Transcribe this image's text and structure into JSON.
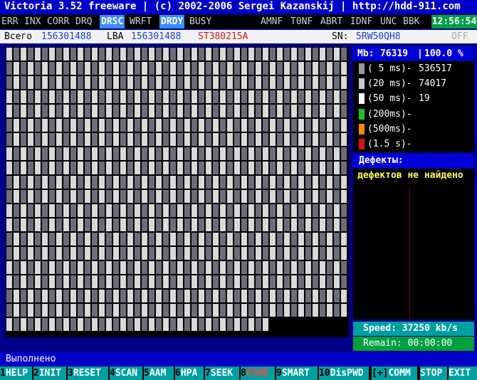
{
  "title_bar": {
    "app": "Victoria 3.52 freeware",
    "copyright": "(c) 2002-2006",
    "author": "Sergei Kazanskij",
    "url": "http://hdd-911.com"
  },
  "status_bar": {
    "flags_left": [
      {
        "label": "ERR",
        "active": false
      },
      {
        "label": "INX",
        "active": false
      },
      {
        "label": "CORR",
        "active": false
      },
      {
        "label": "DRQ",
        "active": false
      },
      {
        "label": "DRSC",
        "active": true
      },
      {
        "label": "WRFT",
        "active": false
      },
      {
        "label": "DRDY",
        "active": true
      },
      {
        "label": "BUSY",
        "active": false
      }
    ],
    "flags_right": [
      {
        "label": "AMNF"
      },
      {
        "label": "T0NF"
      },
      {
        "label": "ABRT"
      },
      {
        "label": "IDNF"
      },
      {
        "label": "UNC"
      },
      {
        "label": "BBK"
      }
    ],
    "clock": "12:56:54"
  },
  "info_bar": {
    "total_label": "Всего",
    "total_value": "156301488",
    "lba_label": "LBA",
    "lba_value": "156301488",
    "model": "ST380215A",
    "sn_label": "SN:",
    "sn_value": "5RW50QH8",
    "off": "OFF"
  },
  "progress": {
    "mb_label": "Mb:",
    "mb_value": "76319",
    "percent": "100.0 %"
  },
  "timing_stats": [
    {
      "label": "( 5 ms)-",
      "value": "536517",
      "color": "#9a9a9a"
    },
    {
      "label": "(20 ms)-",
      "value": "74017",
      "color": "#c8c8c8"
    },
    {
      "label": "(50 ms)-",
      "value": "19",
      "color": "#ffffff"
    },
    {
      "label": "(200ms)-",
      "value": "",
      "color": "#20c020"
    },
    {
      "label": "(500ms)-",
      "value": "",
      "color": "#ff8c00"
    },
    {
      "label": "(1.5 s)-",
      "value": "",
      "color": "#e01010"
    }
  ],
  "defects": {
    "header": "Дефекты:",
    "text": "дефектов не найдено"
  },
  "speed": {
    "label": "Speed:",
    "value": "37250",
    "unit": "kb/s"
  },
  "remain": {
    "label": "Remain:",
    "value": "00:00:00"
  },
  "status_message": "Выполнено",
  "function_keys": [
    {
      "num": "1",
      "label": "HELP",
      "red": false
    },
    {
      "num": "2",
      "label": "INIT",
      "red": false
    },
    {
      "num": "3",
      "label": "RESET",
      "red": false
    },
    {
      "num": "4",
      "label": "SCAN",
      "red": false
    },
    {
      "num": "5",
      "label": "AAM",
      "red": false
    },
    {
      "num": "6",
      "label": "HPA",
      "red": false
    },
    {
      "num": "7",
      "label": "SEEK",
      "red": false
    },
    {
      "num": "8",
      "label": "PSWD",
      "red": true
    },
    {
      "num": "9",
      "label": "SMART",
      "red": false
    },
    {
      "num": "10",
      "label": "DisPWD",
      "red": false
    },
    {
      "num": "[+]",
      "label": "COMM",
      "red": false
    },
    {
      "num": "",
      "label": "STOP",
      "red": false
    },
    {
      "num": "",
      "label": "EXIT",
      "red": false
    }
  ],
  "colors": {
    "block_a": "#6d6d7a",
    "block_b": "#d9d9d9",
    "gap": "#000000"
  }
}
